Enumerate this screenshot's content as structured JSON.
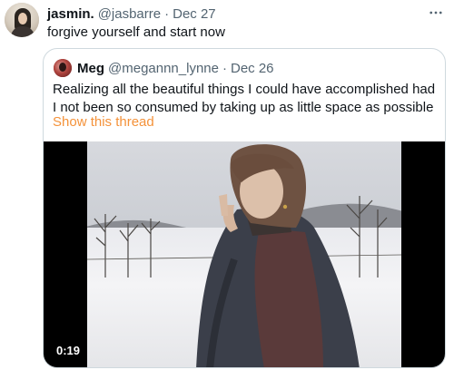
{
  "tweet": {
    "author_name": "jasmin.",
    "author_handle": "@jasbarre",
    "separator": "·",
    "date": "Dec 27",
    "text": "forgive yourself and start now",
    "more_icon": "more-horizontal-icon"
  },
  "quoted_tweet": {
    "author_name": "Meg",
    "author_handle": "@megannn_lynne",
    "separator": "·",
    "date": "Dec 26",
    "text": "Realizing all the beautiful things I could have accomplished had I not been so consumed by taking up as little space as possible",
    "link_label": "Show this thread",
    "link_color": "#f4923a",
    "video": {
      "timestamp": "0:19"
    }
  }
}
